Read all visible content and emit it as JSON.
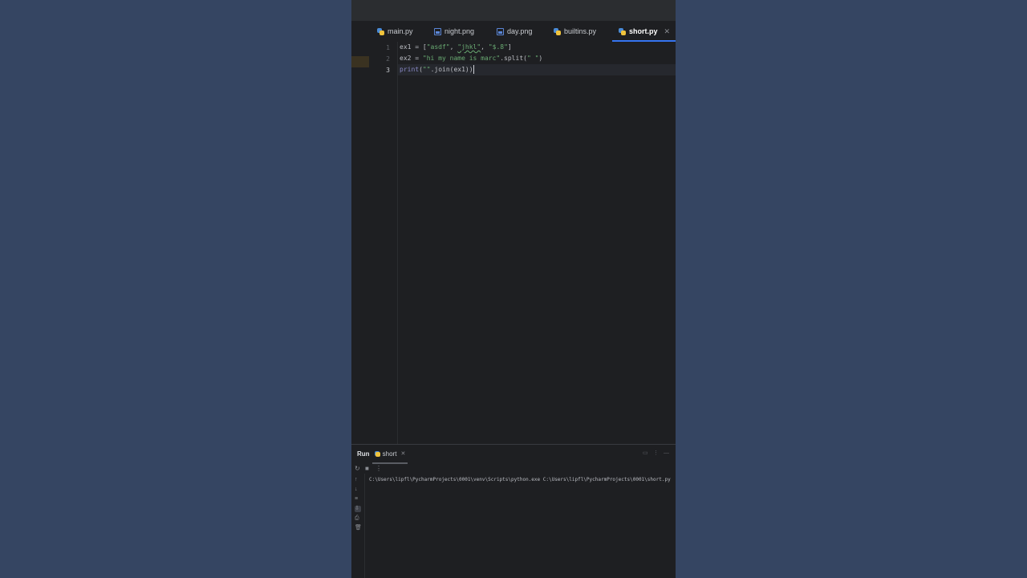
{
  "tabs": [
    {
      "label": "main.py",
      "icon": "python-file-icon",
      "active": false
    },
    {
      "label": "night.png",
      "icon": "image-file-icon",
      "active": false
    },
    {
      "label": "day.png",
      "icon": "image-file-icon",
      "active": false
    },
    {
      "label": "builtins.py",
      "icon": "python-file-icon",
      "active": false
    },
    {
      "label": "short.py",
      "icon": "python-file-icon",
      "active": true
    }
  ],
  "editor": {
    "line_numbers": [
      "1",
      "2",
      "3"
    ],
    "current_line": 3,
    "lines": [
      {
        "text": "ex1 = [\"asdf\", \"jhkl\", \"$.8\"]"
      },
      {
        "text": "ex2 = \"hi my name is marc\".split(\" \")"
      },
      {
        "text": "print(\"\".join(ex1))"
      }
    ]
  },
  "run_panel": {
    "title": "Run",
    "config_tab": "short",
    "console_output": "C:\\Users\\lipfl\\PycharmProjects\\0001\\venv\\Scripts\\python.exe C:\\Users\\lipfl\\PycharmProjects\\0001\\short.py"
  },
  "colors": {
    "page_background": "#354562",
    "editor_background": "#1e1f22",
    "string": "#6aab73",
    "builtin": "#8888c6",
    "accent": "#3574f0"
  }
}
